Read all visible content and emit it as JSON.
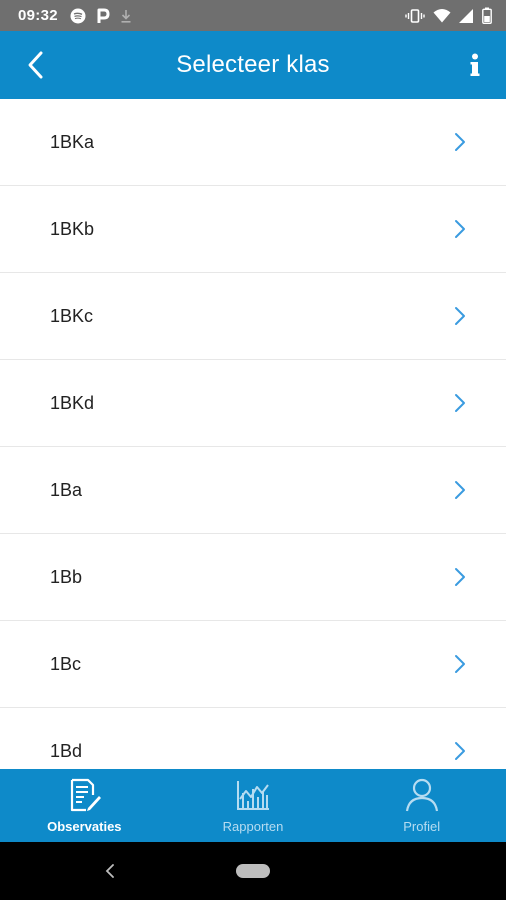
{
  "status_bar": {
    "time": "09:32",
    "left_icons": [
      "spotify-icon",
      "parking-icon",
      "download-icon"
    ],
    "right_icons": [
      "vibrate-icon",
      "wifi-icon",
      "signal-icon",
      "battery-icon"
    ]
  },
  "app_bar": {
    "title": "Selecteer klas",
    "back_icon": "back-chevron-icon",
    "info_icon": "info-icon"
  },
  "class_list": {
    "items": [
      {
        "label": "1BKa"
      },
      {
        "label": "1BKb"
      },
      {
        "label": "1BKc"
      },
      {
        "label": "1BKd"
      },
      {
        "label": "1Ba"
      },
      {
        "label": "1Bb"
      },
      {
        "label": "1Bc"
      },
      {
        "label": "1Bd"
      }
    ]
  },
  "tab_bar": {
    "tabs": [
      {
        "label": "Observaties",
        "icon": "document-edit-icon",
        "active": true
      },
      {
        "label": "Rapporten",
        "icon": "chart-icon",
        "active": false
      },
      {
        "label": "Profiel",
        "icon": "person-icon",
        "active": false
      }
    ]
  },
  "colors": {
    "primary": "#0e8ac9",
    "chevron": "#3a9be0",
    "status_bar": "#6f6f6f",
    "inactive_tab": "#b6dcf1"
  }
}
